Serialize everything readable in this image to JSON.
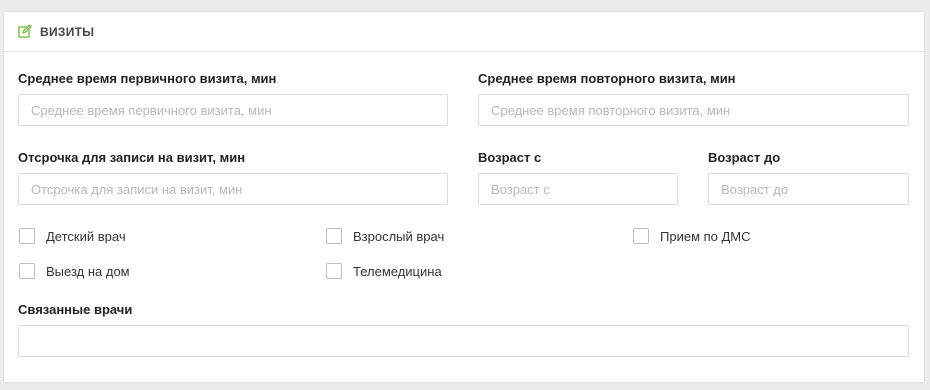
{
  "header": {
    "icon": "edit-icon",
    "title": "визиты",
    "accent_color": "#7ac142"
  },
  "fields": {
    "primary_visit": {
      "label": "Среднее время первичного визита, мин",
      "placeholder": "Среднее время первичного визита, мин",
      "value": ""
    },
    "repeat_visit": {
      "label": "Среднее время повторного визита, мин",
      "placeholder": "Среднее время повторного визита, мин",
      "value": ""
    },
    "booking_delay": {
      "label": "Отсрочка для записи на визит, мин",
      "placeholder": "Отсрочка для записи на визит, мин",
      "value": ""
    },
    "age_from": {
      "label": "Возраст с",
      "placeholder": "Возраст с",
      "value": ""
    },
    "age_to": {
      "label": "Возраст до",
      "placeholder": "Возраст до",
      "value": ""
    },
    "linked_doctors": {
      "label": "Связанные врачи",
      "value": ""
    }
  },
  "checkboxes": {
    "child_doctor": {
      "label": "Детский врач",
      "checked": false
    },
    "adult_doctor": {
      "label": "Взрослый врач",
      "checked": false
    },
    "dms": {
      "label": "Прием по ДМС",
      "checked": false
    },
    "home_visit": {
      "label": "Выезд на дом",
      "checked": false
    },
    "telemedicine": {
      "label": "Телемедицина",
      "checked": false
    }
  }
}
